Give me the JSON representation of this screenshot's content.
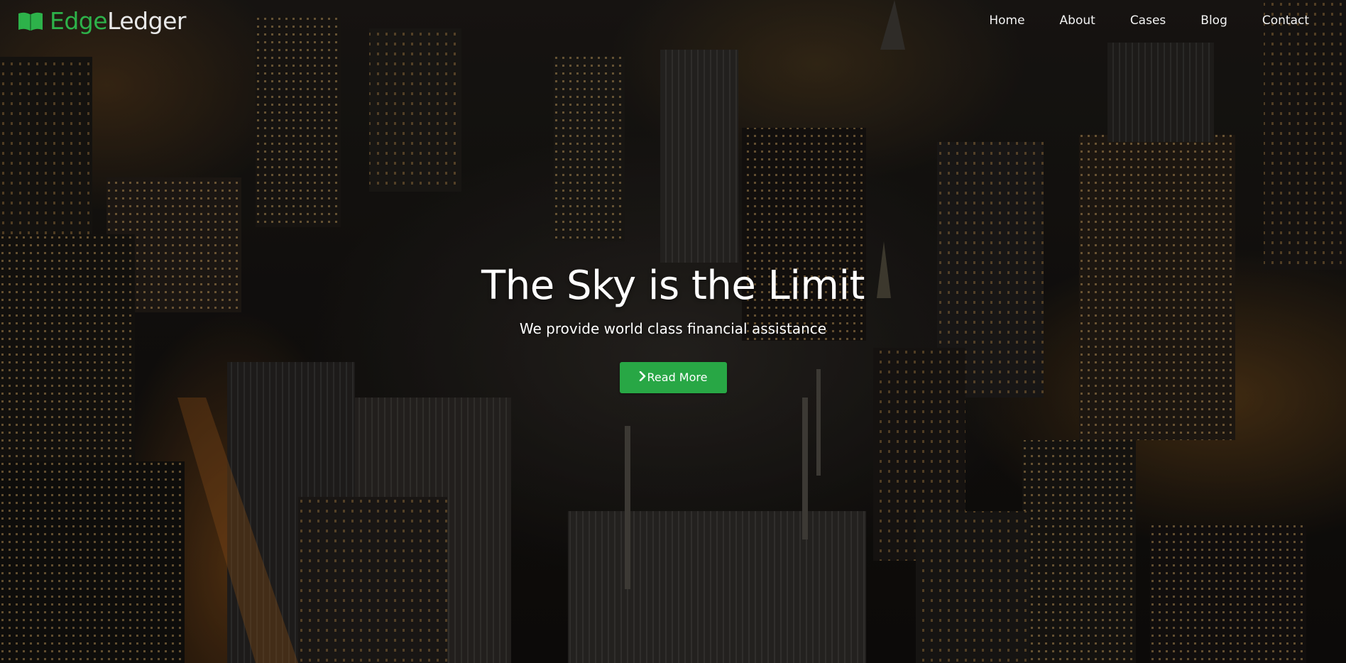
{
  "brand": {
    "name_primary": "Edge",
    "name_secondary": "Ledger",
    "icon": "open-book-icon",
    "accent_color": "#2db24a"
  },
  "nav": {
    "items": [
      {
        "label": "Home"
      },
      {
        "label": "About"
      },
      {
        "label": "Cases"
      },
      {
        "label": "Blog"
      },
      {
        "label": "Contact"
      }
    ]
  },
  "hero": {
    "title": "The Sky is the Limit",
    "subtitle": "We provide world class financial assistance",
    "background": "night-city-aerial-image",
    "cta": {
      "label": "Read More",
      "icon": "chevron-right-icon",
      "color": "#28a745"
    }
  }
}
